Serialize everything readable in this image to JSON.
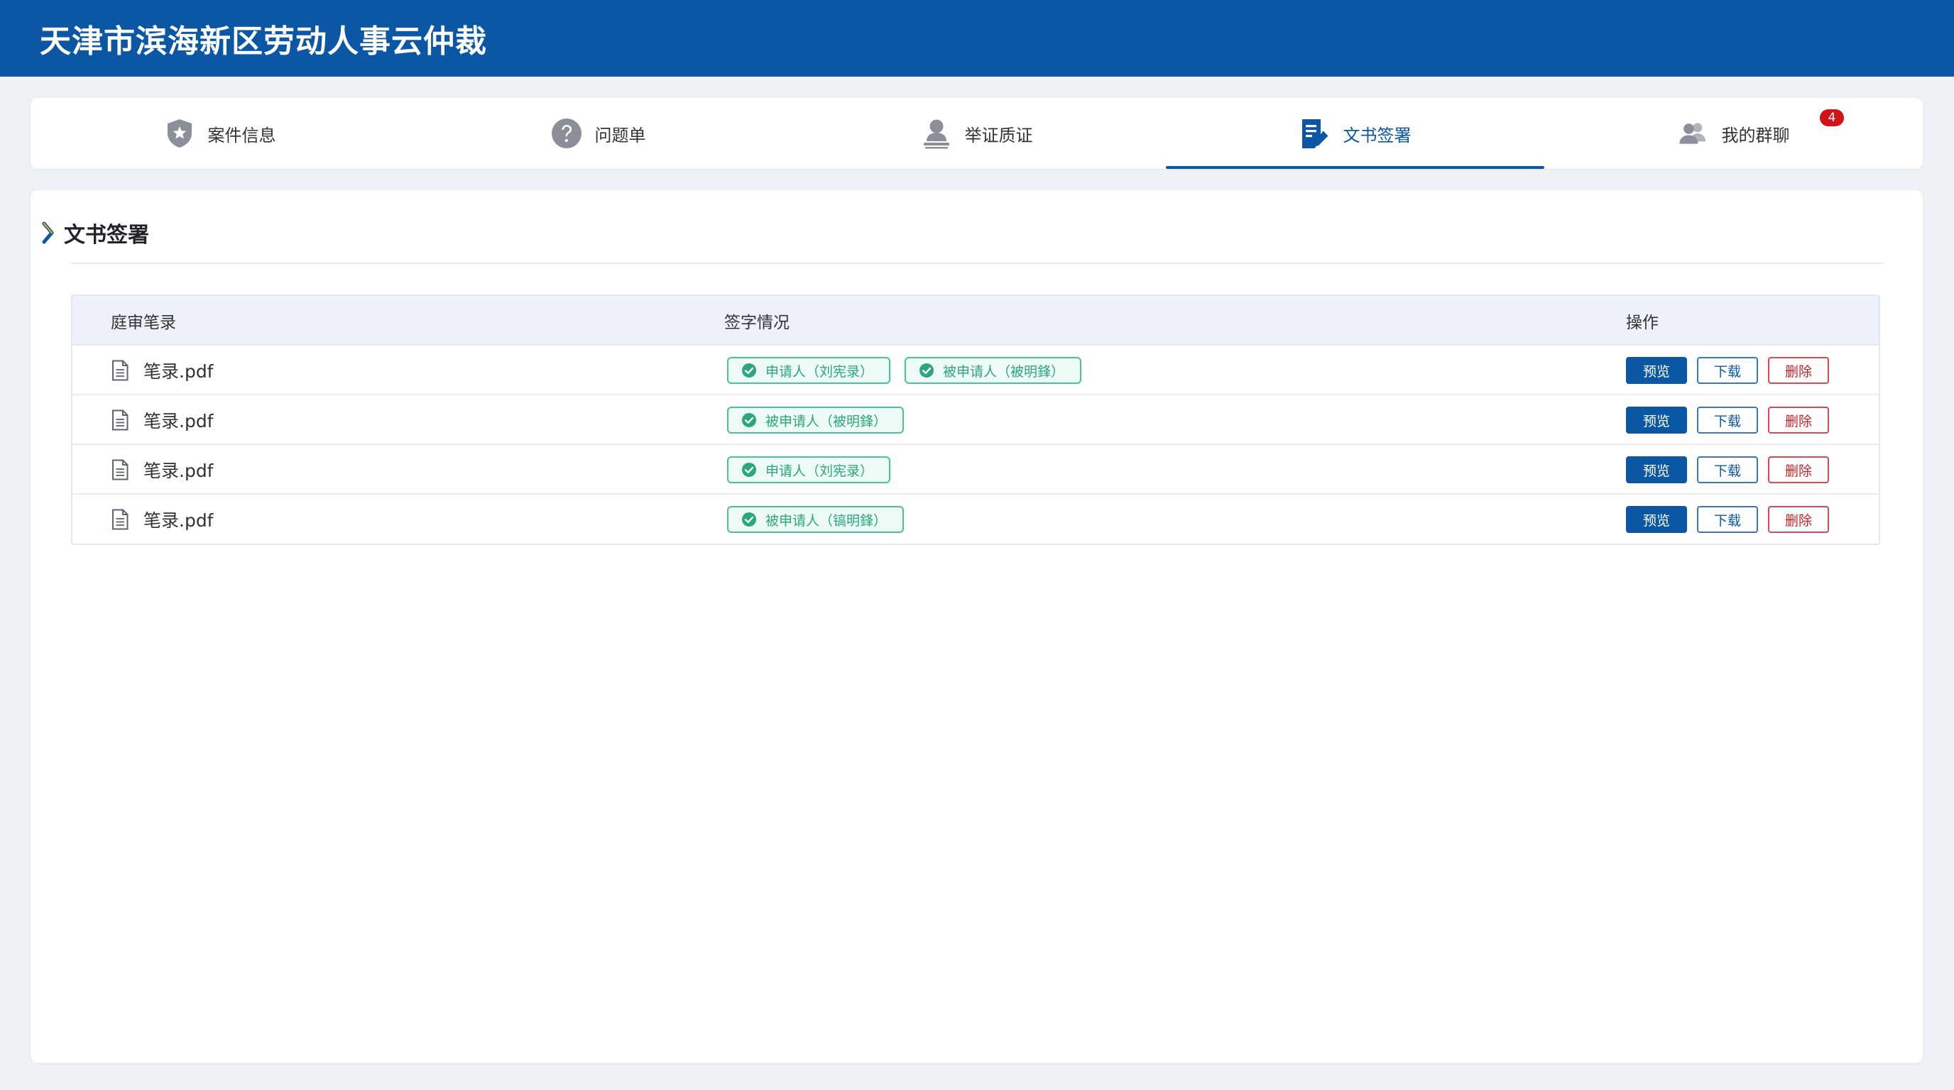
{
  "header": {
    "title": "天津市滨海新区劳动人事云仲裁"
  },
  "tabs": [
    {
      "label": "案件信息",
      "icon": "shield-star-icon",
      "active": false
    },
    {
      "label": "问题单",
      "icon": "question-circle-icon",
      "active": false
    },
    {
      "label": "举证质证",
      "icon": "user-stamp-icon",
      "active": false
    },
    {
      "label": "文书签署",
      "icon": "document-sign-icon",
      "active": true
    },
    {
      "label": "我的群聊",
      "icon": "user-group-icon",
      "active": false,
      "badge": "4"
    }
  ],
  "section": {
    "title": "文书签署"
  },
  "table": {
    "headers": {
      "record": "庭审笔录",
      "signature": "签字情况",
      "actions": "操作"
    },
    "rows": [
      {
        "file": "笔录.pdf",
        "tags": [
          "申请人（刘宪录）",
          "被申请人（被明鋒）"
        ]
      },
      {
        "file": "笔录.pdf",
        "tags": [
          "被申请人（被明鋒）"
        ]
      },
      {
        "file": "笔录.pdf",
        "tags": [
          "申请人（刘宪录）"
        ]
      },
      {
        "file": "笔录.pdf",
        "tags": [
          "被申请人（镐明鋒）"
        ]
      }
    ],
    "actions": {
      "preview": "预览",
      "download": "下载",
      "delete": "删除"
    }
  },
  "colors": {
    "brand": "#0b57a4",
    "signed_green": "#2aa77c",
    "delete_red": "#cc2026",
    "badge_red": "#d0141a"
  }
}
